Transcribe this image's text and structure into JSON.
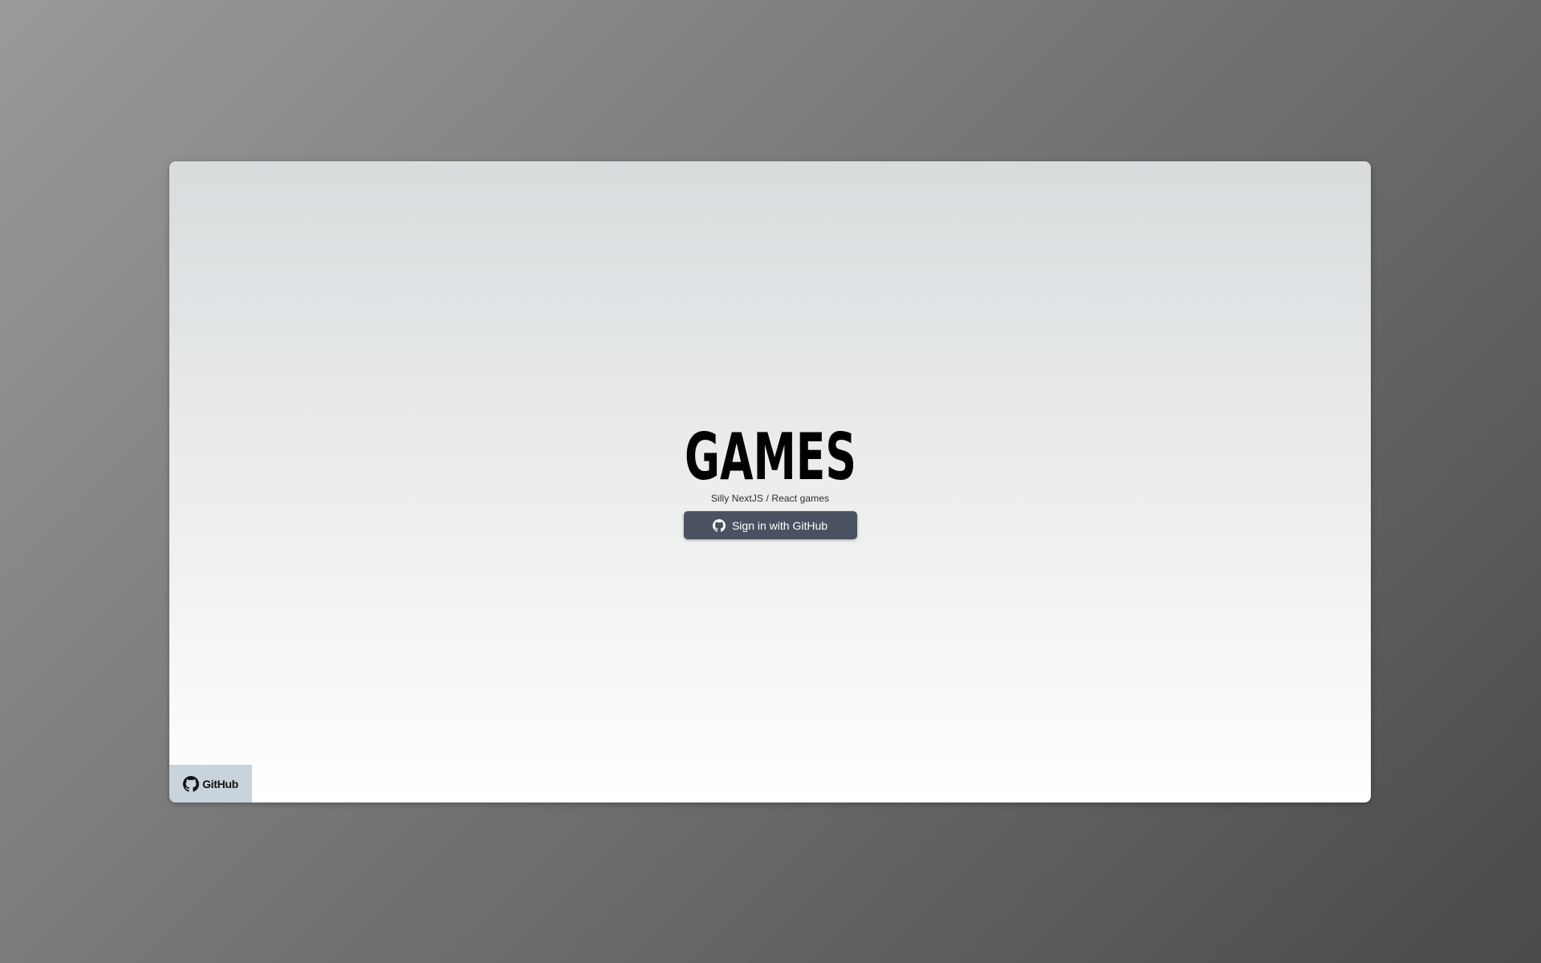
{
  "logo": {
    "text": "GAMES",
    "color": "#000000"
  },
  "subtitle": "Silly NextJS / React games",
  "signin_button": {
    "label": "Sign in with GitHub",
    "icon": "github-icon",
    "background": "#4a5261",
    "text_color": "#ffffff"
  },
  "github_link": {
    "label": "GitHub",
    "icon": "github-icon",
    "background": "#c9d3de"
  }
}
